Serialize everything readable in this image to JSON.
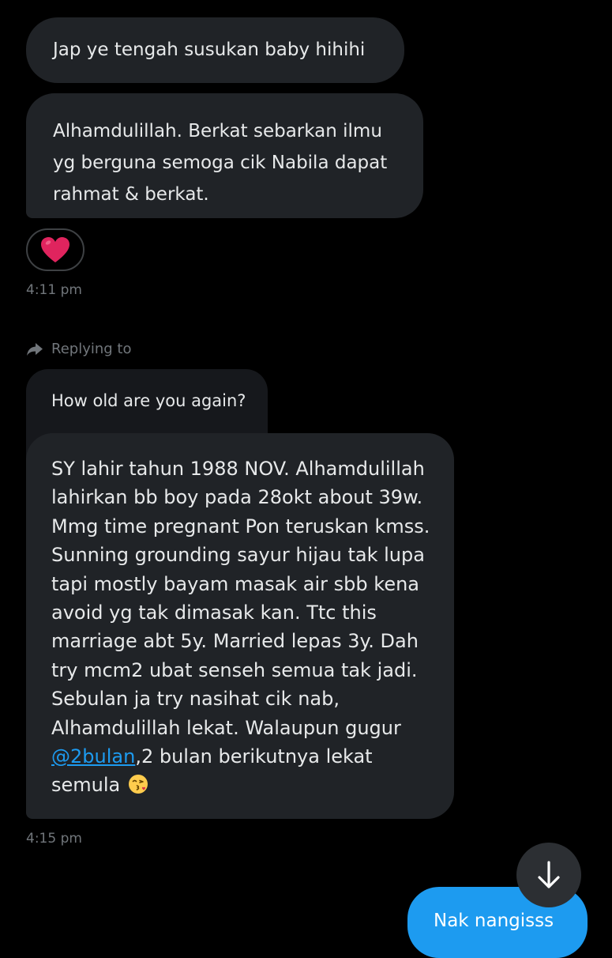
{
  "messages": [
    {
      "text": "Jap ye tengah susukan baby hihihi"
    },
    {
      "text": "Alhamdulillah. Berkat sebarkan ilmu yg berguna semoga cik Nabila dapat rahmat & berkat."
    }
  ],
  "reaction": {
    "emoji": "heart",
    "color": "#e0245e"
  },
  "timestamps": {
    "first": "4:11 pm",
    "second": "4:15 pm"
  },
  "reply": {
    "label": "Replying to",
    "quoted_text": "How old are you again?",
    "message_before_mention": "SY lahir tahun 1988 NOV. Alhamdulillah lahirkan bb boy pada 28okt about 39w. Mmg time pregnant Pon teruskan kmss. Sunning grounding sayur hijau tak lupa tapi mostly bayam masak air sbb kena avoid yg tak dimasak kan. Ttc this marriage abt 5y. Married lepas 3y. Dah try mcm2 ubat senseh semua tak jadi. Sebulan ja try nasihat cik nab, Alhamdulillah lekat. Walaupun gugur ",
    "mention": "@2bulan",
    "message_after_mention": ",2 bulan berikutnya lekat semula ",
    "emoji": "kissing-face-with-heart"
  },
  "outgoing": {
    "text": "Nak nangisss"
  },
  "colors": {
    "accent": "#1d9bf0",
    "bubble": "#202327",
    "muted": "#71767b"
  }
}
